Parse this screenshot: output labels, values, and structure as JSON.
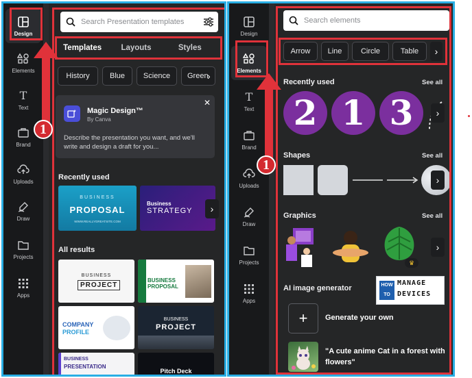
{
  "left": {
    "rail": [
      {
        "label": "Design",
        "icon": "layout-icon",
        "active": true
      },
      {
        "label": "Elements",
        "icon": "shapes-icon"
      },
      {
        "label": "Text",
        "icon": "text-icon"
      },
      {
        "label": "Brand",
        "icon": "brand-icon"
      },
      {
        "label": "Uploads",
        "icon": "cloud-upload-icon"
      },
      {
        "label": "Draw",
        "icon": "draw-icon"
      },
      {
        "label": "Projects",
        "icon": "folder-icon"
      },
      {
        "label": "Apps",
        "icon": "apps-grid-icon"
      }
    ],
    "search_placeholder": "Search Presentation templates",
    "tabs": [
      "Templates",
      "Layouts",
      "Styles"
    ],
    "chips": [
      "History",
      "Blue",
      "Science",
      "Green"
    ],
    "magic": {
      "title": "Magic Design™",
      "subtitle": "By Canva",
      "body": "Describe the presentation you want, and we'll write and design a draft for you..."
    },
    "recently_used_title": "Recently used",
    "recent_templates": [
      {
        "top": "BUSINESS",
        "main": "PROPOSAL",
        "foot": "WWW.REALLYGREATSITE.COM"
      },
      {
        "top": "Business",
        "main": "STRATEGY"
      }
    ],
    "all_results_title": "All results",
    "results": [
      {
        "top": "BUSINESS",
        "main": "PROJECT"
      },
      {
        "top": "BUSINESS",
        "main": "PROPOSAL"
      },
      {
        "top": "COMPANY",
        "main": "PROFILE"
      },
      {
        "top": "BUSINESS",
        "main": "PROJECT"
      },
      {
        "top": "BUSINESS",
        "main": "PRESENTATION"
      },
      {
        "main": "Pitch Deck"
      }
    ],
    "callout_number": "1"
  },
  "right": {
    "rail": [
      {
        "label": "Design",
        "icon": "layout-icon"
      },
      {
        "label": "Elements",
        "icon": "shapes-icon",
        "active": true
      },
      {
        "label": "Text",
        "icon": "text-icon"
      },
      {
        "label": "Brand",
        "icon": "brand-icon"
      },
      {
        "label": "Uploads",
        "icon": "cloud-upload-icon"
      },
      {
        "label": "Draw",
        "icon": "draw-icon"
      },
      {
        "label": "Projects",
        "icon": "folder-icon"
      },
      {
        "label": "Apps",
        "icon": "apps-grid-icon"
      }
    ],
    "search_placeholder": "Search elements",
    "chips": [
      "Arrow",
      "Line",
      "Circle",
      "Table"
    ],
    "see_all": "See all",
    "recently_used_title": "Recently used",
    "recent_numbers": [
      "2",
      "1",
      "3"
    ],
    "shapes_title": "Shapes",
    "graphics_title": "Graphics",
    "ai_title": "AI image generator",
    "ai_generate": "Generate your own",
    "ai_prompt": "\"A cute anime Cat in a forest with flowers\"",
    "callout_number": "1",
    "watermark": {
      "line1": "HOW TO",
      "line2": "MANAGE",
      "line3": "DEVICES"
    }
  },
  "colors": {
    "accent_red": "#e0323a",
    "frame_blue": "#29aee4",
    "numbers_purple": "#7b2f9e"
  }
}
